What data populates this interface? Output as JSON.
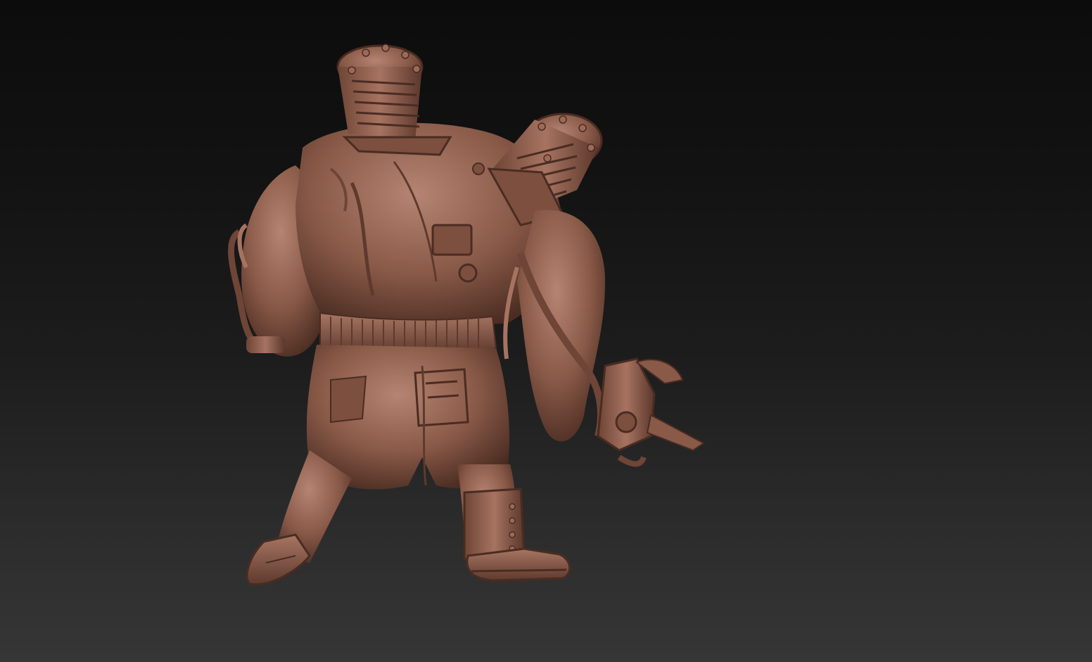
{
  "viewport": {
    "background_top": "#0c0c0c",
    "background_bottom": "#363636"
  },
  "model": {
    "subject": "sculpted-creature-back-view",
    "material_color": "#8a5a48",
    "material_highlight": "#b58472",
    "material_shadow": "#4a2c22"
  }
}
